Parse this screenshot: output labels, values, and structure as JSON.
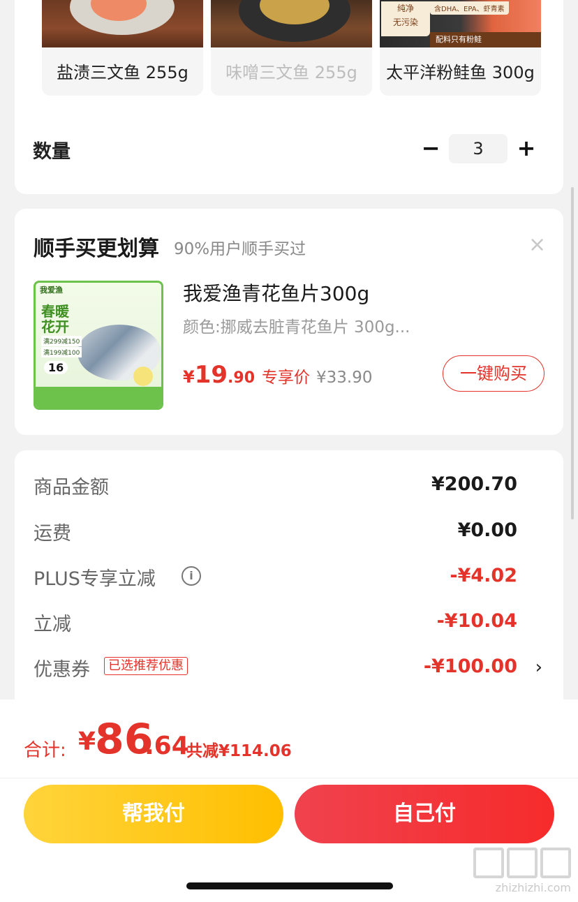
{
  "variants": [
    {
      "label": "盐渍三文鱼 255g",
      "state": "normal"
    },
    {
      "label": "味噌三文鱼 255g",
      "state": "disabled"
    },
    {
      "label": "太平洋粉鲑鱼 300g",
      "state": "normal",
      "badge_pure": "纯净\n无污染",
      "badge_top": "含DHA、EPA、虾青素",
      "badge_strip": "配料只有粉鲑"
    }
  ],
  "quantity": {
    "label": "数量",
    "minus": "−",
    "value": "3",
    "plus": "+"
  },
  "upsell": {
    "title": "顺手买更划算",
    "subtitle": "90%用户顺手买过",
    "close": "×",
    "product": {
      "thumb_brand": "我爱渔",
      "thumb_headline": "春暖\n花开",
      "thumb_deal_1": "满299减150",
      "thumb_deal_2": "满199减100",
      "thumb_price": "16",
      "name": "我爱渔青花鱼片300g",
      "spec": "颜色:挪威去脏青花鱼片 300g...",
      "price_yen": "¥",
      "price_int": "19",
      "price_dec": ".90",
      "price_tag": "专享价",
      "original_price": "¥33.90",
      "buy_label": "一键购买"
    }
  },
  "breakdown": [
    {
      "label": "商品金额",
      "value": "¥200.70",
      "red": false
    },
    {
      "label": "运费",
      "value": "¥0.00",
      "red": false
    },
    {
      "label": "PLUS专享立减",
      "value": "-¥4.02",
      "red": true
    },
    {
      "label": "立减",
      "value": "-¥10.04",
      "red": true
    },
    {
      "label": "优惠券",
      "value": "-¥100.00",
      "red": true
    }
  ],
  "coupon_tag": "已选推荐优惠",
  "info_icon": "i",
  "chevron": "›",
  "footer": {
    "total_label": "合计:",
    "total_yen": "¥",
    "total_int": "86",
    "total_dec": ".64",
    "total_saved": "共减¥114.06",
    "help_pay": "帮我付",
    "self_pay": "自己付",
    "watermark": "zhizhizhi.com"
  },
  "colors": {
    "accent_red": "#e4332a",
    "yellow": "#ffc61a"
  }
}
